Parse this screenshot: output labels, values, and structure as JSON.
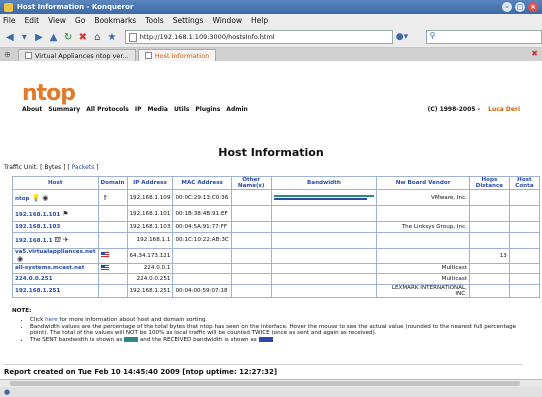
{
  "window": {
    "title": "Host Information - Konqueror"
  },
  "menu": [
    "File",
    "Edit",
    "View",
    "Go",
    "Bookmarks",
    "Tools",
    "Settings",
    "Window",
    "Help"
  ],
  "toolbar": {
    "url": "http://192.168.1.109:3000/hostsInfo.html"
  },
  "tabs": [
    {
      "label": "Virtual Appliances ntop ver..."
    },
    {
      "label": "Host Information"
    }
  ],
  "page": {
    "logo": "ntop",
    "nav": [
      "About",
      "Summary",
      "All Protocols",
      "IP",
      "Media",
      "Utils",
      "Plugins",
      "Admin"
    ],
    "copyright": "(C) 1998-2005 - ",
    "author": "Luca Deri",
    "title": "Host Information",
    "traffic_unit_label": "Traffic Unit: [ Bytes ] [ ",
    "traffic_unit_link": "Packets",
    "traffic_unit_close": " ]"
  },
  "table": {
    "headers": [
      "Host",
      "Domain",
      "IP Address",
      "MAC Address",
      "Other Name(s)",
      "Bandwidth",
      "Nw Board Vendor",
      "Hops Distance",
      "Host Conta"
    ],
    "rows": [
      {
        "host": "ntop",
        "ip": "192.168.1.109",
        "mac": "00:0C:29:13:C0:36",
        "vendor": "VMware, Inc.",
        "hops": "",
        "sent": 1.0,
        "recv": 0.93
      },
      {
        "host": "192.168.1.101",
        "ip": "192.168.1.101",
        "mac": "00:1B:38:4B:91:EF",
        "vendor": "",
        "hops": "",
        "sent": 0,
        "recv": 0
      },
      {
        "host": "192.168.1.103",
        "ip": "192.168.1.103",
        "mac": "00:04:5A:91:77:FF",
        "vendor": "The Linksys Group, Inc.",
        "hops": "",
        "sent": 0,
        "recv": 0
      },
      {
        "host": "192.168.1.1",
        "ip": "192.168.1.1",
        "mac": "00:1C:10:22:AB:3C",
        "vendor": "",
        "hops": "",
        "sent": 0,
        "recv": 0
      },
      {
        "host": "va5.virtualappliances.net",
        "ip": "64.34.173.121",
        "mac": "",
        "vendor": "",
        "hops": "13",
        "sent": 0,
        "recv": 0
      },
      {
        "host": "all-systems.mcast.net",
        "ip": "224.0.0.1",
        "mac": "",
        "vendor": "Multicast",
        "hops": "",
        "sent": 0,
        "recv": 0
      },
      {
        "host": "224.0.0.251",
        "ip": "224.0.0.251",
        "mac": "",
        "vendor": "Multicast",
        "hops": "",
        "sent": 0,
        "recv": 0
      },
      {
        "host": "192.168.1.251",
        "ip": "192.168.1.251",
        "mac": "00:04:00:59:07:18",
        "vendor": "LEXMARK INTERNATIONAL, INC.",
        "hops": "",
        "sent": 0,
        "recv": 0
      }
    ]
  },
  "notes": {
    "heading": "NOTE:",
    "item1_pre": "Click ",
    "item1_link": "here",
    "item1_post": " for more information about host and domain sorting.",
    "item2": "Bandwidth values are the percentage of the total bytes that ntop has seen on the interface. Hover the mouse to see the actual value (rounded to the nearest full percentage point). The total of the values will NOT be 100% as local traffic will be counted TWICE (once as sent and again as received).",
    "item3_a": "The SENT bandwidth is shown as ",
    "item3_b": " and the RECEIVED bandwidth is shown as "
  },
  "report": "Report created on Tue Feb 10 14:45:40 2009 [ntop uptime: 12:27:32]"
}
